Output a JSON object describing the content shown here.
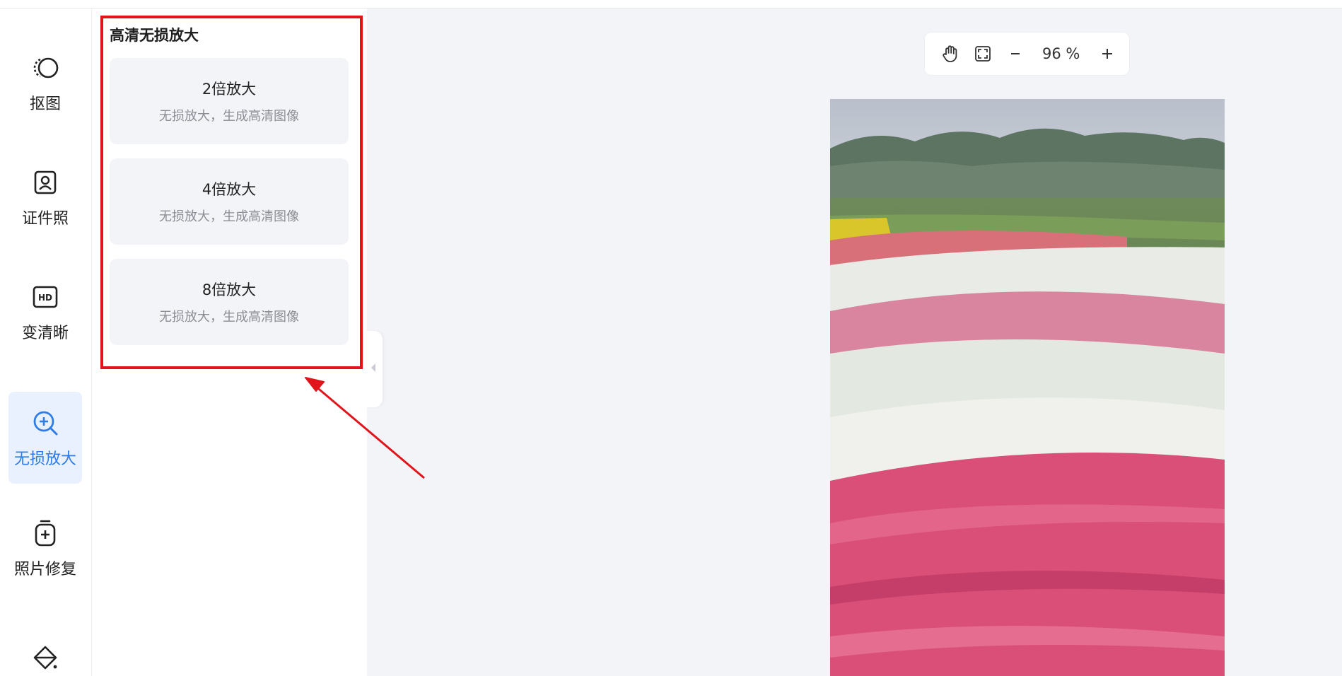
{
  "nav": {
    "items": [
      {
        "label": "抠图",
        "icon": "cutout-icon",
        "active": false
      },
      {
        "label": "证件照",
        "icon": "id-photo-icon",
        "active": false
      },
      {
        "label": "变清晰",
        "icon": "hd-icon",
        "active": false
      },
      {
        "label": "无损放大",
        "icon": "zoom-in-icon",
        "active": true
      },
      {
        "label": "照片修复",
        "icon": "photo-repair-icon",
        "active": false
      },
      {
        "label": "",
        "icon": "eraser-icon",
        "active": false
      }
    ]
  },
  "panel": {
    "title": "高清无损放大",
    "options": [
      {
        "title": "2倍放大",
        "subtitle": "无损放大，生成高清图像"
      },
      {
        "title": "4倍放大",
        "subtitle": "无损放大，生成高清图像"
      },
      {
        "title": "8倍放大",
        "subtitle": "无损放大，生成高清图像"
      }
    ]
  },
  "zoombar": {
    "value": "96 %",
    "pan_icon": "hand-icon",
    "fit_icon": "fit-screen-icon",
    "minus_icon": "minus-icon",
    "plus_icon": "plus-icon"
  },
  "canvas": {
    "image": "tulip-field-photo"
  },
  "colors": {
    "accent": "#2f7ce6",
    "highlight": "#e0141a",
    "canvas_bg": "#f3f4f8"
  }
}
